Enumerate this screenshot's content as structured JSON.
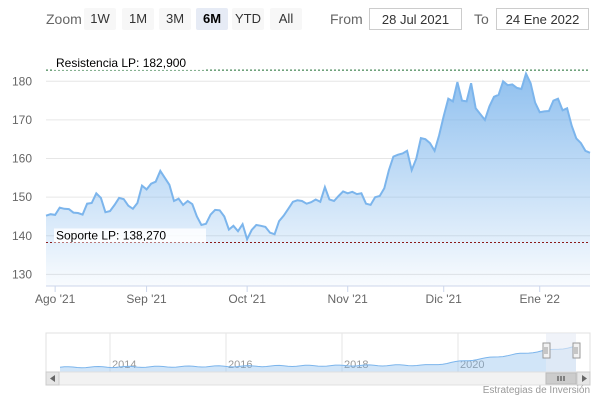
{
  "toolbar": {
    "zoom_label": "Zoom",
    "zoom_buttons": [
      "1W",
      "1M",
      "3M",
      "6M",
      "YTD",
      "All"
    ],
    "active_zoom": "6M",
    "from_label": "From",
    "from_value": "28 Jul 2021",
    "to_label": "To",
    "to_value": "24 Ene 2022"
  },
  "colors": {
    "line": "#7cb5ec",
    "resistance": "#1a6b2e",
    "support": "#8b1a1a",
    "navigator_mask": "#e6ebf5"
  },
  "chart_data": {
    "type": "area",
    "title": "",
    "xlabel": "",
    "ylabel": "",
    "ylim": [
      127,
      185
    ],
    "yticks": [
      130,
      140,
      150,
      160,
      170,
      180
    ],
    "x_tick_labels": [
      "Ago '21",
      "Sep '21",
      "Oct '21",
      "Nov '21",
      "Dic '21",
      "Ene '22"
    ],
    "grid": true,
    "legend": "none",
    "series": [
      {
        "values": [
          145.2,
          145.6,
          145.4,
          147.3,
          147.0,
          146.9,
          146.0,
          145.9,
          145.5,
          148.3,
          148.5,
          151.0,
          149.8,
          146.1,
          146.4,
          148.0,
          149.8,
          149.5,
          147.8,
          147.0,
          148.5,
          153.0,
          152.0,
          153.5,
          154.0,
          156.8,
          155.0,
          153.2,
          149.0,
          149.6,
          148.0,
          149.0,
          148.2,
          145.0,
          142.8,
          143.1,
          145.5,
          146.7,
          146.6,
          145.0,
          141.6,
          142.6,
          141.2,
          143.0,
          139.1,
          141.5,
          142.8,
          142.6,
          142.3,
          140.8,
          140.4,
          143.8,
          145.2,
          147.0,
          148.8,
          149.2,
          149.0,
          148.3,
          148.7,
          149.4,
          148.8,
          152.6,
          149.4,
          149.0,
          150.3,
          151.5,
          151.0,
          151.4,
          150.8,
          151.0,
          148.3,
          148.0,
          150.0,
          150.3,
          152.3,
          157.0,
          160.5,
          161.0,
          161.3,
          162.0,
          157.0,
          160.0,
          165.3,
          165.0,
          164.0,
          162.0,
          166.0,
          171.0,
          175.5,
          174.8,
          179.8,
          175.0,
          174.8,
          179.5,
          173.0,
          171.5,
          170.0,
          173.5,
          176.0,
          176.5,
          180.0,
          179.0,
          179.2,
          178.3,
          178.0,
          182.0,
          179.5,
          174.5,
          172.0,
          172.2,
          172.3,
          175.0,
          175.5,
          172.5,
          173.0,
          168.5,
          165.2,
          164.0,
          162.0,
          161.5
        ]
      }
    ],
    "annotations": [
      {
        "label": "Resistencia LP: 182,900",
        "value": 182.9
      },
      {
        "label": "Soporte LP: 138,270",
        "value": 138.27
      }
    ],
    "navigator": {
      "year_labels": [
        "2014",
        "2016",
        "2018",
        "2020"
      ]
    }
  },
  "credits": "Estrategias de Inversión"
}
